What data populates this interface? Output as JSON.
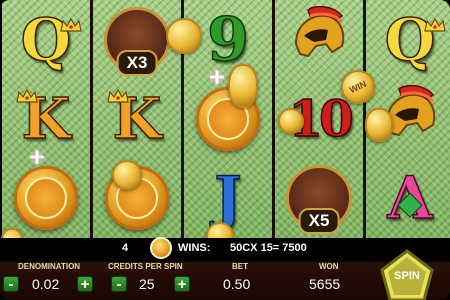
{
  "reels": [
    [
      {
        "symbol": "q"
      },
      {
        "symbol": "k"
      },
      {
        "symbol": "coin"
      }
    ],
    [
      {
        "symbol": "bonus",
        "text": "X3"
      },
      {
        "symbol": "k"
      },
      {
        "symbol": "coin"
      }
    ],
    [
      {
        "symbol": "9"
      },
      {
        "symbol": "coin"
      },
      {
        "symbol": "j"
      }
    ],
    [
      {
        "symbol": "helmet"
      },
      {
        "symbol": "10"
      },
      {
        "symbol": "bonus",
        "text": "X5"
      }
    ],
    [
      {
        "symbol": "q"
      },
      {
        "symbol": "helmet"
      },
      {
        "symbol": "a"
      }
    ]
  ],
  "symbol_glyphs": {
    "q": "Q",
    "k": "K",
    "9": "9",
    "10": "10",
    "j": "J",
    "a": "A"
  },
  "falling_coin_text": "WIN",
  "info": {
    "lines": "4",
    "wins_label": "WINS:",
    "win_formula": "50CX 15= 7500"
  },
  "controls": {
    "denomination": {
      "label": "DENOMINATION",
      "value": "0.02",
      "minus": "-",
      "plus": "+"
    },
    "credits_per_spin": {
      "label": "CREDITS PER SPIN",
      "value": "25",
      "minus": "-",
      "plus": "+"
    },
    "bet": {
      "label": "BET",
      "value": "0.50"
    },
    "won": {
      "label": "WON",
      "value": "5655"
    },
    "spin_label": "SPIN"
  },
  "colors": {
    "reel_background": "#8fbf6a",
    "panel": "#2a0f08",
    "button_green": "#3fa536",
    "spin_button": "#e8e25a",
    "coin_gold": "#e39a1f"
  }
}
